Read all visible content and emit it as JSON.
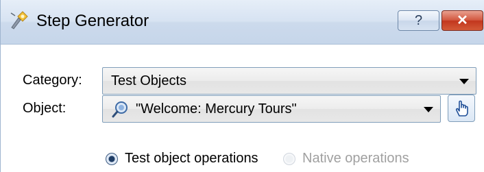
{
  "window": {
    "title": "Step Generator",
    "help_label": "?",
    "close_label": "✕"
  },
  "category": {
    "label": "Category:",
    "value": "Test Objects"
  },
  "object": {
    "label": "Object:",
    "value": "\"Welcome: Mercury Tours\""
  },
  "operations": {
    "test_object_label": "Test object operations",
    "native_label": "Native operations",
    "selected": "test_object"
  },
  "colors": {
    "title_bg": "#d7e3f2",
    "close_red": "#c2361d",
    "disabled_text": "#a0a0a0"
  },
  "icons": {
    "app": "step-generator-icon",
    "object": "object-spy-icon",
    "pick": "hand-pointer-icon"
  }
}
